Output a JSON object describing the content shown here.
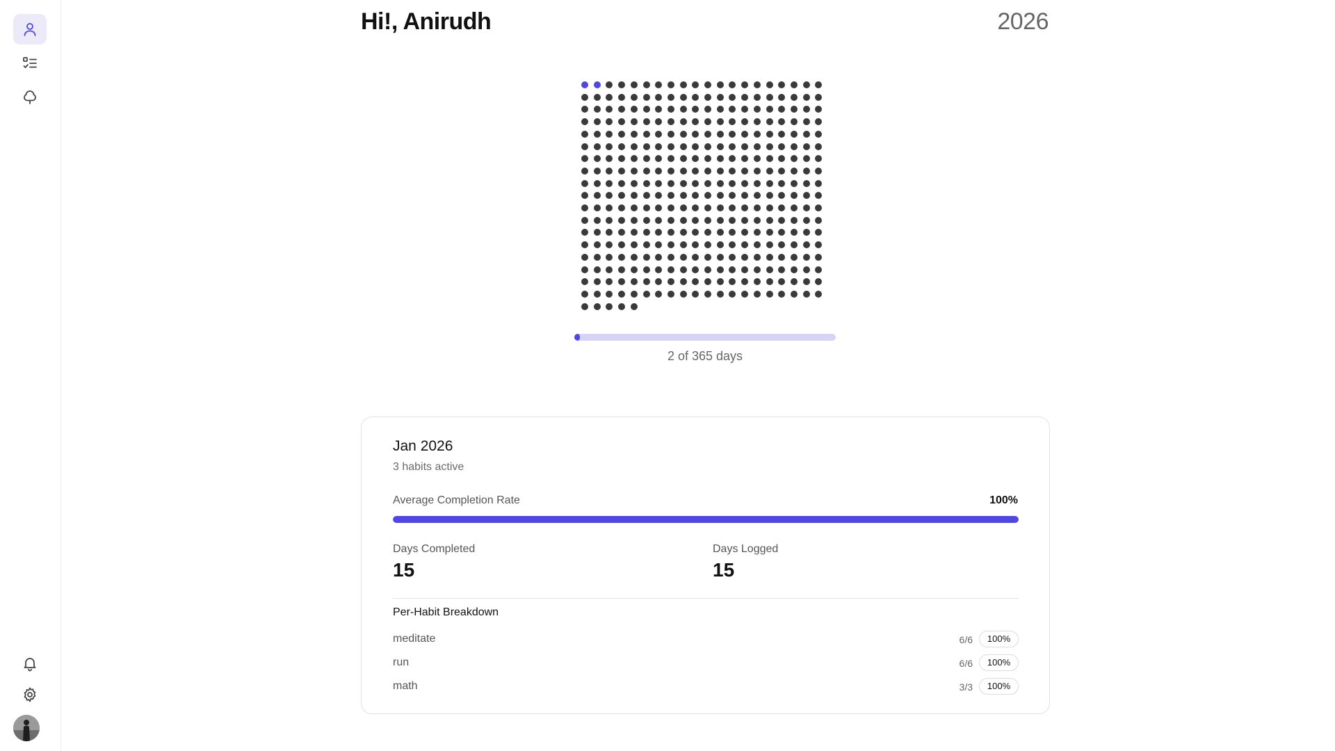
{
  "sidebar": {
    "top_items": [
      {
        "icon": "user-icon",
        "active": true
      },
      {
        "icon": "checklist-icon",
        "active": false
      },
      {
        "icon": "tree-icon",
        "active": false
      }
    ],
    "bottom_items": [
      {
        "icon": "bell-icon"
      },
      {
        "icon": "gear-icon"
      }
    ]
  },
  "header": {
    "greeting": "Hi!, Anirudh",
    "year": "2026"
  },
  "year_grid": {
    "total_days": 365,
    "completed_days": 2,
    "columns": 20
  },
  "year_progress": {
    "label": "2 of 365 days",
    "fraction": 0.0055
  },
  "month_card": {
    "title": "Jan 2026",
    "subtitle": "3 habits active",
    "avg_completion_label": "Average Completion Rate",
    "avg_completion_value": "100%",
    "avg_completion_fraction": 1.0,
    "days_completed_label": "Days Completed",
    "days_completed_value": "15",
    "days_logged_label": "Days Logged",
    "days_logged_value": "15",
    "breakdown_title": "Per-Habit Breakdown",
    "habits": [
      {
        "name": "meditate",
        "count": "6/6",
        "percent": "100%"
      },
      {
        "name": "run",
        "count": "6/6",
        "percent": "100%"
      },
      {
        "name": "math",
        "count": "3/3",
        "percent": "100%"
      }
    ]
  },
  "colors": {
    "accent": "#4f46e5",
    "accent_light": "#d6d4f6",
    "dot_default": "#3a3a3a",
    "active_nav_bg": "#eceaf9"
  }
}
